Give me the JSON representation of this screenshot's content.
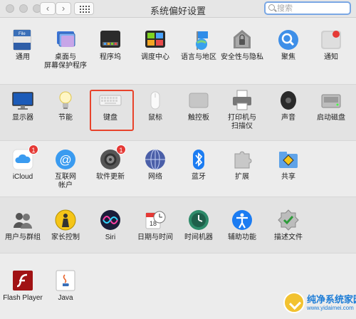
{
  "window": {
    "title": "系统偏好设置",
    "back": "‹",
    "forward": "›"
  },
  "search": {
    "placeholder": "搜索"
  },
  "rows": [
    [
      {
        "label": "通用",
        "icon": "general-icon"
      },
      {
        "label": "桌面与\n屏幕保护程序",
        "icon": "desktop-screensaver-icon"
      },
      {
        "label": "程序坞",
        "icon": "dock-icon"
      },
      {
        "label": "调度中心",
        "icon": "mission-control-icon"
      },
      {
        "label": "语言与地区",
        "icon": "language-region-icon"
      },
      {
        "label": "安全性与隐私",
        "icon": "security-privacy-icon"
      },
      {
        "label": "聚焦",
        "icon": "spotlight-icon"
      },
      {
        "label": "通知",
        "icon": "notifications-icon"
      }
    ],
    [
      {
        "label": "显示器",
        "icon": "displays-icon"
      },
      {
        "label": "节能",
        "icon": "energy-saver-icon"
      },
      {
        "label": "键盘",
        "icon": "keyboard-icon"
      },
      {
        "label": "鼠标",
        "icon": "mouse-icon"
      },
      {
        "label": "触控板",
        "icon": "trackpad-icon"
      },
      {
        "label": "打印机与\n扫描仪",
        "icon": "printers-scanners-icon"
      },
      {
        "label": "声音",
        "icon": "sound-icon"
      },
      {
        "label": "启动磁盘",
        "icon": "startup-disk-icon"
      }
    ],
    [
      {
        "label": "iCloud",
        "icon": "icloud-icon",
        "badge": "1"
      },
      {
        "label": "互联网\n帐户",
        "icon": "internet-accounts-icon"
      },
      {
        "label": "软件更新",
        "icon": "software-update-icon",
        "badge": "1"
      },
      {
        "label": "网络",
        "icon": "network-icon"
      },
      {
        "label": "蓝牙",
        "icon": "bluetooth-icon"
      },
      {
        "label": "扩展",
        "icon": "extensions-icon"
      },
      {
        "label": "共享",
        "icon": "sharing-icon"
      }
    ],
    [
      {
        "label": "用户与群组",
        "icon": "users-groups-icon"
      },
      {
        "label": "家长控制",
        "icon": "parental-controls-icon"
      },
      {
        "label": "Siri",
        "icon": "siri-icon"
      },
      {
        "label": "日期与时间",
        "icon": "date-time-icon"
      },
      {
        "label": "时间机器",
        "icon": "time-machine-icon"
      },
      {
        "label": "辅助功能",
        "icon": "accessibility-icon"
      },
      {
        "label": "描述文件",
        "icon": "profiles-icon"
      }
    ],
    [
      {
        "label": "Flash Player",
        "icon": "flash-player-icon"
      },
      {
        "label": "Java",
        "icon": "java-icon"
      }
    ]
  ],
  "watermark": {
    "title": "纯净系统家园",
    "url": "www.yidaimei.com"
  },
  "colors": {
    "highlight": "#e8432b",
    "search_focus": "#7aa7e4",
    "badge": "#e53935"
  }
}
